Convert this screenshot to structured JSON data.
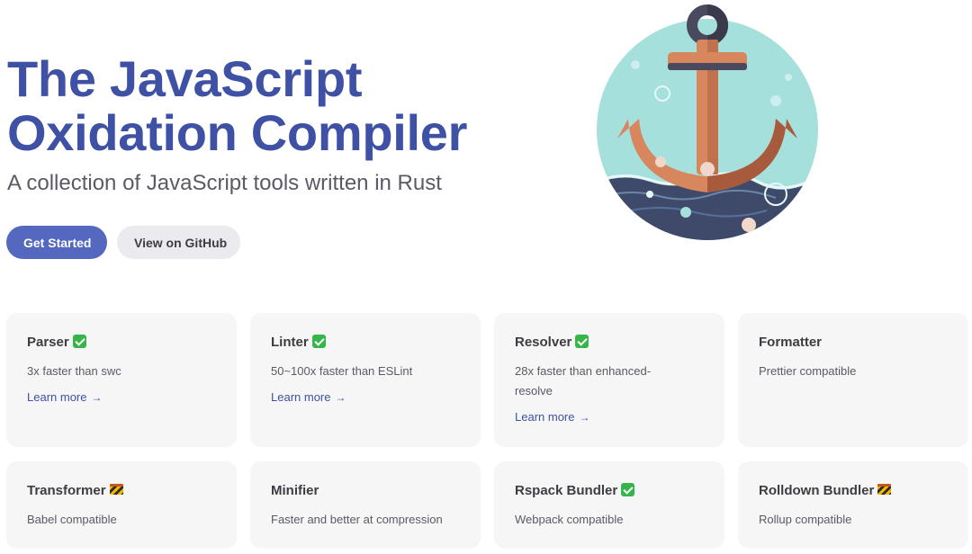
{
  "hero": {
    "title_line1": "The JavaScript",
    "title_line2": "Oxidation Compiler",
    "tagline": "A collection of JavaScript tools written in Rust",
    "primary_action": "Get Started",
    "secondary_action": "View on GitHub",
    "image_icon": "anchor-icon"
  },
  "features": [
    {
      "title": "Parser",
      "status": "done",
      "desc": "3x faster than swc",
      "link": "Learn more"
    },
    {
      "title": "Linter",
      "status": "done",
      "desc": "50~100x faster than ESLint",
      "link": "Learn more"
    },
    {
      "title": "Resolver",
      "status": "done",
      "desc": "28x faster than enhanced-resolve",
      "link": "Learn more"
    },
    {
      "title": "Formatter",
      "status": "",
      "desc": "Prettier compatible",
      "link": ""
    },
    {
      "title": "Transformer",
      "status": "wip",
      "desc": "Babel compatible",
      "link": ""
    },
    {
      "title": "Minifier",
      "status": "",
      "desc": "Faster and better at compression",
      "link": ""
    },
    {
      "title": "Rspack Bundler",
      "status": "done",
      "desc": "Webpack compatible",
      "link": ""
    },
    {
      "title": "Rolldown Bundler",
      "status": "wip",
      "desc": "Rollup compatible",
      "link": ""
    }
  ],
  "icons": {
    "done": "check-mark-icon",
    "wip": "construction-icon",
    "link_arrow": "arrow-right-icon"
  },
  "colors": {
    "brand": "#3f51a4",
    "primary_button": "#5468c0",
    "card_background": "#f6f6f7",
    "check": "#36b64a"
  }
}
